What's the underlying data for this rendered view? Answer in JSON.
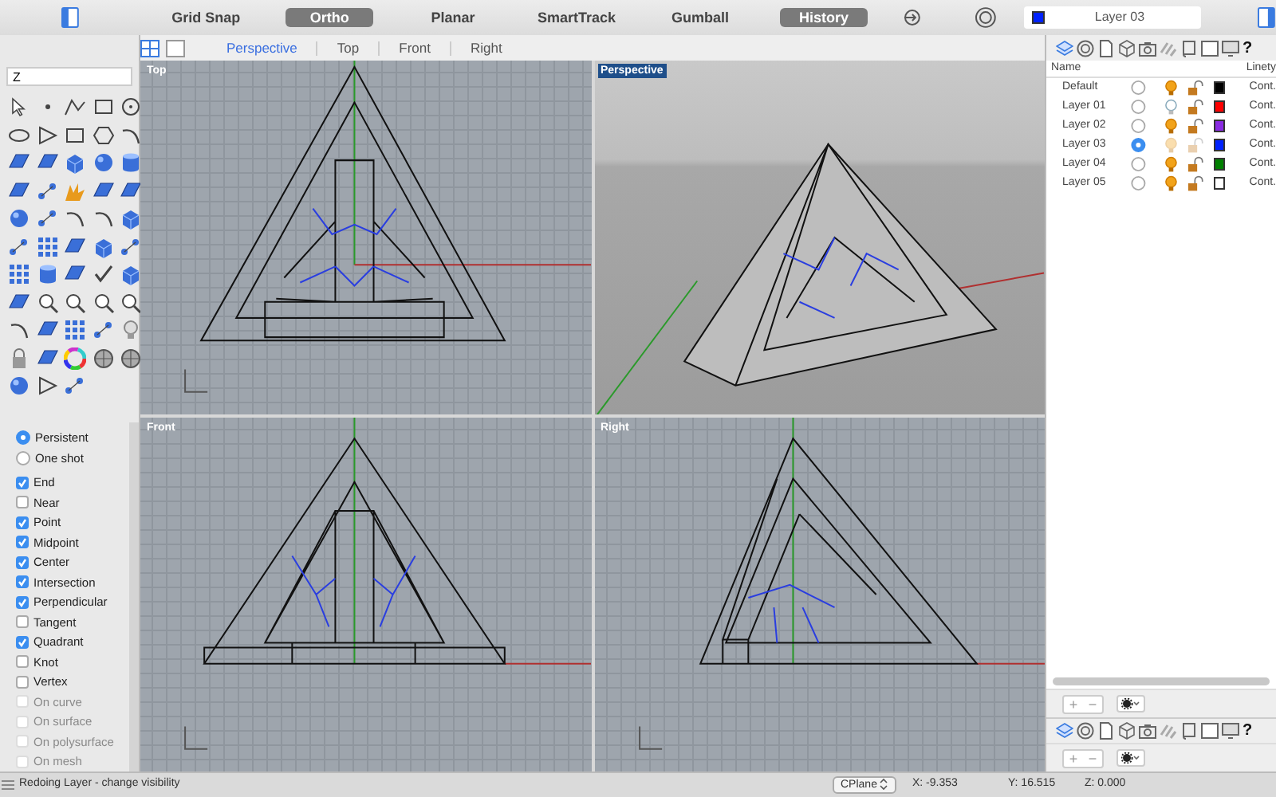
{
  "toolbar": {
    "buttons": [
      {
        "label": "Grid Snap",
        "on": false
      },
      {
        "label": "Ortho",
        "on": true
      },
      {
        "label": "Planar",
        "on": false
      },
      {
        "label": "SmartTrack",
        "on": false
      },
      {
        "label": "Gumball",
        "on": false
      },
      {
        "label": "History",
        "on": true
      }
    ]
  },
  "viewport_tabs": [
    {
      "label": "Perspective",
      "selected": true
    },
    {
      "label": "Top",
      "selected": false
    },
    {
      "label": "Front",
      "selected": false
    },
    {
      "label": "Right",
      "selected": false
    }
  ],
  "current_layer_field": {
    "value": "Layer 03"
  },
  "command_field": {
    "value": "Z"
  },
  "osnap": {
    "modes": [
      {
        "label": "Persistent",
        "selected": true
      },
      {
        "label": "One shot",
        "selected": false
      }
    ],
    "snaps": [
      {
        "label": "End",
        "checked": true,
        "disabled": false
      },
      {
        "label": "Near",
        "checked": false,
        "disabled": false
      },
      {
        "label": "Point",
        "checked": true,
        "disabled": false
      },
      {
        "label": "Midpoint",
        "checked": true,
        "disabled": false
      },
      {
        "label": "Center",
        "checked": true,
        "disabled": false
      },
      {
        "label": "Intersection",
        "checked": true,
        "disabled": false
      },
      {
        "label": "Perpendicular",
        "checked": true,
        "disabled": false
      },
      {
        "label": "Tangent",
        "checked": false,
        "disabled": false
      },
      {
        "label": "Quadrant",
        "checked": true,
        "disabled": false
      },
      {
        "label": "Knot",
        "checked": false,
        "disabled": false
      },
      {
        "label": "Vertex",
        "checked": false,
        "disabled": false
      },
      {
        "label": "On curve",
        "checked": false,
        "disabled": true
      },
      {
        "label": "On surface",
        "checked": false,
        "disabled": true
      },
      {
        "label": "On polysurface",
        "checked": false,
        "disabled": true
      },
      {
        "label": "On mesh",
        "checked": false,
        "disabled": true
      }
    ]
  },
  "viewports": [
    {
      "title": "Top",
      "kind": "top",
      "active": false
    },
    {
      "title": "Perspective",
      "kind": "perspective",
      "active": true
    },
    {
      "title": "Front",
      "kind": "front",
      "active": false
    },
    {
      "title": "Right",
      "kind": "right",
      "active": false
    }
  ],
  "layers_panel": {
    "help_label": "?",
    "columns": [
      "Name",
      "Linety"
    ],
    "rows": [
      {
        "name": "Default",
        "current": false,
        "visible": true,
        "locked": false,
        "color": "#000000",
        "linetype": "Cont."
      },
      {
        "name": "Layer 01",
        "current": false,
        "visible": false,
        "locked": false,
        "color": "#ff0000",
        "linetype": "Cont."
      },
      {
        "name": "Layer 02",
        "current": false,
        "visible": true,
        "locked": false,
        "color": "#8a2be2",
        "linetype": "Cont."
      },
      {
        "name": "Layer 03",
        "current": true,
        "visible": true,
        "locked": false,
        "color": "#0022ff",
        "linetype": "Cont."
      },
      {
        "name": "Layer 04",
        "current": false,
        "visible": true,
        "locked": false,
        "color": "#008000",
        "linetype": "Cont."
      },
      {
        "name": "Layer 05",
        "current": false,
        "visible": true,
        "locked": false,
        "color": "#ffffff",
        "linetype": "Cont."
      }
    ],
    "add_label": "+",
    "remove_label": "−"
  },
  "lower_panel": {
    "help_label": "?",
    "add_label": "+",
    "remove_label": "−"
  },
  "status_bar": {
    "message": "Redoing Layer - change visibility",
    "cplane": "CPlane",
    "x": "X: -9.353",
    "y": "Y: 16.515",
    "z": "Z: 0.000"
  }
}
